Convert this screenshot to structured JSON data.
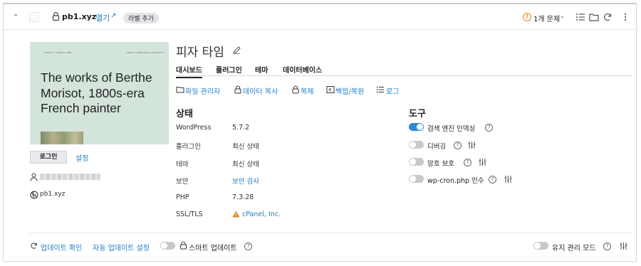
{
  "header": {
    "domain": "pb1.xyz",
    "open_label": "열기",
    "add_label": "라벨 추가",
    "issues_label": "1개 문제"
  },
  "preview": {
    "site_mini_title": "TWENTY TWENTY-ONE",
    "site_mini_nav": "ABOUT  HOME  BLOG  CONTACT",
    "headline": "The works of Berthe Morisot, 1800s-era French painter"
  },
  "left": {
    "login_button": "로그인",
    "settings_link": "설정",
    "url_text": "pb1.xyz"
  },
  "site": {
    "title": "피자 타임"
  },
  "tabs": [
    {
      "label": "대시보드"
    },
    {
      "label": "플러그인"
    },
    {
      "label": "테마"
    },
    {
      "label": "데이터베이스"
    }
  ],
  "actions": [
    {
      "label": "파일 관리자"
    },
    {
      "label": "데이터 복사"
    },
    {
      "label": "복제"
    },
    {
      "label": "백업/복원"
    },
    {
      "label": "로그"
    }
  ],
  "status": {
    "heading": "상태",
    "rows": [
      {
        "key": "WordPress",
        "value": "5.7.2"
      },
      {
        "key": "플러그인",
        "value": "최신 상태"
      },
      {
        "key": "테마",
        "value": "최신 상태"
      },
      {
        "key": "보안",
        "value": "보안 검사"
      },
      {
        "key": "PHP",
        "value": "7.3.28"
      },
      {
        "key": "SSL/TLS",
        "value": "cPanel, Inc."
      }
    ]
  },
  "tools": {
    "heading": "도구",
    "items": [
      {
        "label": "검색 엔진 인덱싱",
        "on": true
      },
      {
        "label": "디버깅",
        "on": false
      },
      {
        "label": "암호 보호",
        "on": false
      },
      {
        "label": "wp-cron.php 인수",
        "on": false
      }
    ]
  },
  "footer": {
    "check_updates": "업데이트 확인",
    "auto_update_settings": "자동 업데이트 설정",
    "smart_update": "스마트 업데이트",
    "maintenance_mode": "유지 관리 모드"
  },
  "colors": {
    "accent": "#1f7ec9",
    "toggle_on": "#2b8ad8",
    "warning": "#e8821c",
    "preview_bg": "#d3e4db"
  }
}
